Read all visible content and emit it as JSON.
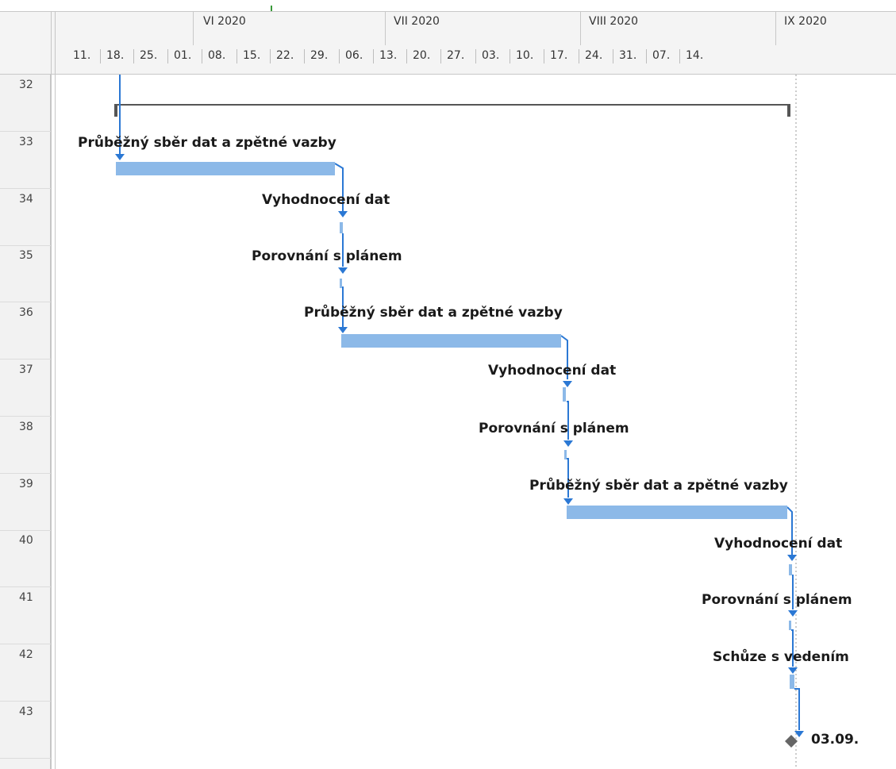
{
  "row_numbers": [
    "32",
    "33",
    "34",
    "35",
    "36",
    "37",
    "38",
    "39",
    "40",
    "41",
    "42",
    "43"
  ],
  "timescale": {
    "months": [
      "VI 2020",
      "VII 2020",
      "VIII 2020",
      "IX 2020"
    ],
    "weeks": [
      "11.",
      "18.",
      "25.",
      "01.",
      "08.",
      "15.",
      "22.",
      "29.",
      "06.",
      "13.",
      "20.",
      "27.",
      "03.",
      "10.",
      "17.",
      "24.",
      "31.",
      "07.",
      "14."
    ]
  },
  "tasks": [
    {
      "row": "33",
      "label": "Průběžný sběr dat a zpětné vazby"
    },
    {
      "row": "34",
      "label": "Vyhodnocení dat"
    },
    {
      "row": "35",
      "label": "Porovnání s plánem"
    },
    {
      "row": "36",
      "label": "Průběžný sběr dat a zpětné vazby"
    },
    {
      "row": "37",
      "label": "Vyhodnocení dat"
    },
    {
      "row": "38",
      "label": "Porovnání s plánem"
    },
    {
      "row": "39",
      "label": "Průběžný sběr dat a zpětné vazby"
    },
    {
      "row": "40",
      "label": "Vyhodnocení dat"
    },
    {
      "row": "41",
      "label": "Porovnání s plánem"
    },
    {
      "row": "42",
      "label": "Schůze s vedením"
    }
  ],
  "milestone": {
    "row": "43",
    "label": "03.09."
  },
  "colors": {
    "task_bar": "#8cb9e8",
    "link": "#2b78d4",
    "summary": "#555555",
    "milestone": "#666666",
    "status_line": "#9a9a9a"
  }
}
